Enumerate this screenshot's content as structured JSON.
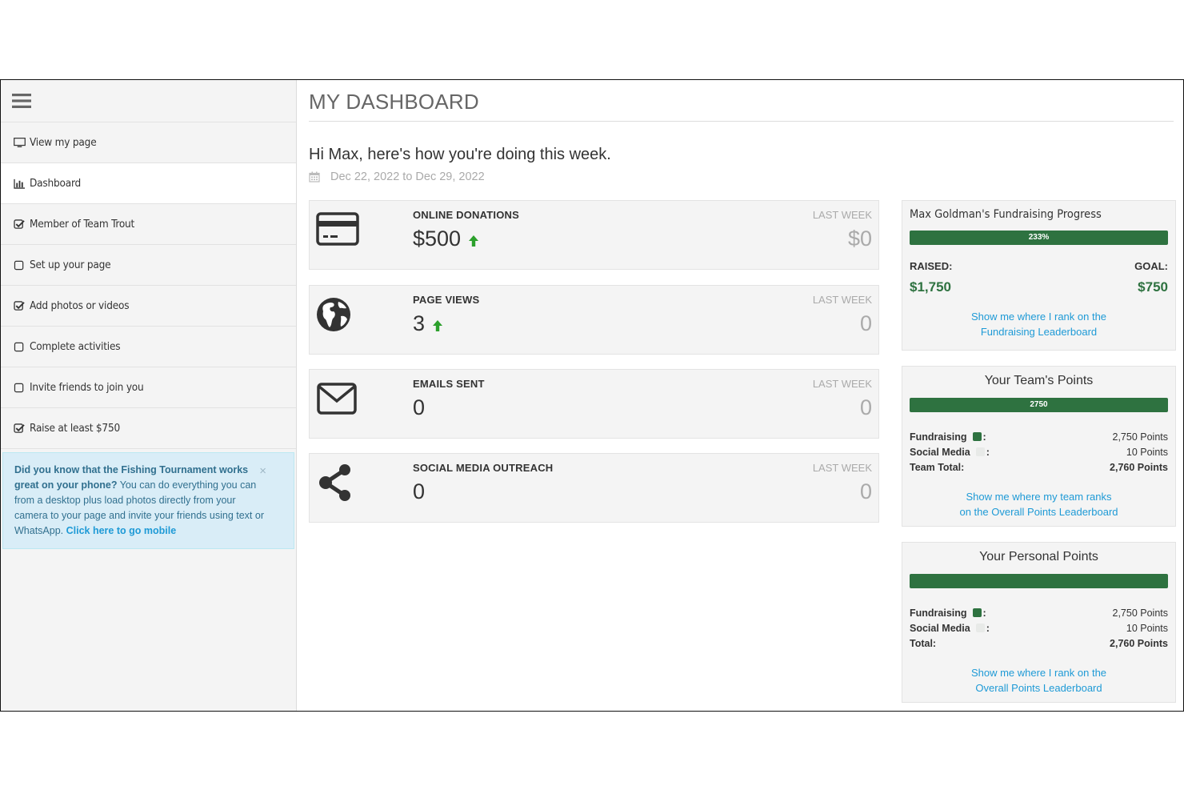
{
  "sidebar": {
    "items": [
      {
        "label": "View my page",
        "icon": "monitor-icon"
      },
      {
        "label": "Dashboard",
        "icon": "bar-chart-icon",
        "active": true
      },
      {
        "label": "Member of Team Trout",
        "icon": "checked-box-icon"
      },
      {
        "label": "Set up your page",
        "icon": "empty-checkbox-icon"
      },
      {
        "label": "Add photos or videos",
        "icon": "checked-box-icon"
      },
      {
        "label": "Complete activities",
        "icon": "empty-checkbox-icon"
      },
      {
        "label": "Invite friends to join you",
        "icon": "empty-checkbox-icon"
      },
      {
        "label": "Raise at least $750",
        "icon": "checked-box-icon"
      }
    ],
    "alert": {
      "bold": "Did you know that the Fishing Tournament works great on your phone?",
      "text": " You can do everything you can from a desktop plus load photos directly from your camera to your page and invite your friends using text or WhatsApp. ",
      "link": "Click here to go mobile",
      "close": "×"
    }
  },
  "main": {
    "title": "MY DASHBOARD",
    "greeting": "Hi Max, here's how you're doing this week.",
    "date_range": "Dec 22, 2022 to Dec 29, 2022",
    "stats": [
      {
        "label": "ONLINE DONATIONS",
        "value": "$500",
        "trend": "up",
        "last_week_label": "LAST WEEK",
        "last_week_value": "$0",
        "icon": "credit-card-icon"
      },
      {
        "label": "PAGE VIEWS",
        "value": "3",
        "trend": "up",
        "last_week_label": "LAST WEEK",
        "last_week_value": "0",
        "icon": "globe-icon"
      },
      {
        "label": "EMAILS SENT",
        "value": "0",
        "last_week_label": "LAST WEEK",
        "last_week_value": "0",
        "icon": "envelope-icon"
      },
      {
        "label": "SOCIAL MEDIA OUTREACH",
        "value": "0",
        "last_week_label": "LAST WEEK",
        "last_week_value": "0",
        "icon": "share-icon"
      }
    ]
  },
  "progress": {
    "title": "Max Goldman's Fundraising Progress",
    "bar_label": "233%",
    "progress_fraction": 1.0,
    "raised_label": "RAISED:",
    "goal_label": "GOAL:",
    "raised": "$1,750",
    "goal": "$750",
    "link_line1": "Show me where I rank on the",
    "link_line2": "Fundraising Leaderboard"
  },
  "team_points": {
    "title": "Your Team's Points",
    "bar_label": "2750",
    "rows": [
      {
        "label": "Fundraising",
        "value": "2,750 Points"
      },
      {
        "label": "Social Media",
        "value": "10 Points"
      },
      {
        "label": "Team Total:",
        "value": "2,760 Points"
      }
    ],
    "link_line1": "Show me where my team ranks",
    "link_line2": "on the Overall Points Leaderboard"
  },
  "personal_points": {
    "title": "Your Personal Points",
    "rows": [
      {
        "label": "Fundraising",
        "value": "2,750 Points"
      },
      {
        "label": "Social Media",
        "value": "10 Points"
      },
      {
        "label": "Total:",
        "value": "2,760 Points"
      }
    ],
    "link_line1": "Show me where I rank on the",
    "link_line2": "Overall Points Leaderboard"
  },
  "colors": {
    "accent_green": "#2e7240",
    "link_blue": "#1e9ad6",
    "up_arrow_green": "#2ca02c"
  }
}
